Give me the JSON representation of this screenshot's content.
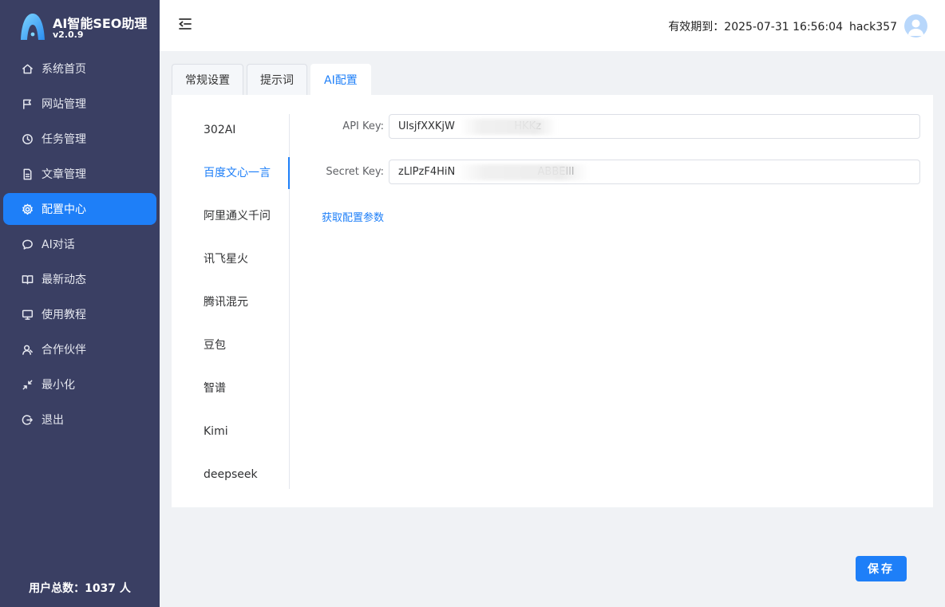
{
  "brand": {
    "title": "AI智能SEO助理",
    "version": "v2.0.9"
  },
  "sidebar": {
    "items": [
      {
        "label": "系统首页",
        "icon": "home-icon"
      },
      {
        "label": "网站管理",
        "icon": "flag-icon"
      },
      {
        "label": "任务管理",
        "icon": "clock-icon"
      },
      {
        "label": "文章管理",
        "icon": "document-icon"
      },
      {
        "label": "配置中心",
        "icon": "gear-icon",
        "active": true
      },
      {
        "label": "AI对话",
        "icon": "chat-icon"
      },
      {
        "label": "最新动态",
        "icon": "book-icon"
      },
      {
        "label": "使用教程",
        "icon": "monitor-icon"
      },
      {
        "label": "合作伙伴",
        "icon": "user-icon"
      },
      {
        "label": "最小化",
        "icon": "minimize-icon"
      },
      {
        "label": "退出",
        "icon": "logout-icon"
      }
    ],
    "user_count": "用户总数：1037 人"
  },
  "header": {
    "expiry_label": "有效期到：2025-07-31 16:56:04",
    "username": "hack357"
  },
  "tabs": [
    {
      "label": "常规设置"
    },
    {
      "label": "提示词"
    },
    {
      "label": "AI配置",
      "active": true
    }
  ],
  "providers": [
    {
      "label": "302AI"
    },
    {
      "label": "百度文心一言",
      "active": true
    },
    {
      "label": "阿里通义千问"
    },
    {
      "label": "讯飞星火"
    },
    {
      "label": "腾讯混元"
    },
    {
      "label": "豆包"
    },
    {
      "label": "智谱"
    },
    {
      "label": "Kimi"
    },
    {
      "label": "deepseek"
    }
  ],
  "form": {
    "api_key_label": "API Key:",
    "api_key_value": "UlsjfXXKjW                  HKKz",
    "secret_key_label": "Secret Key:",
    "secret_key_value": "zLlPzF4HiN                         ABBEIll",
    "config_link": "获取配置参数"
  },
  "save_label": "保存",
  "colors": {
    "sidebar_bg": "#3a3f63",
    "accent": "#1e7ff8"
  }
}
